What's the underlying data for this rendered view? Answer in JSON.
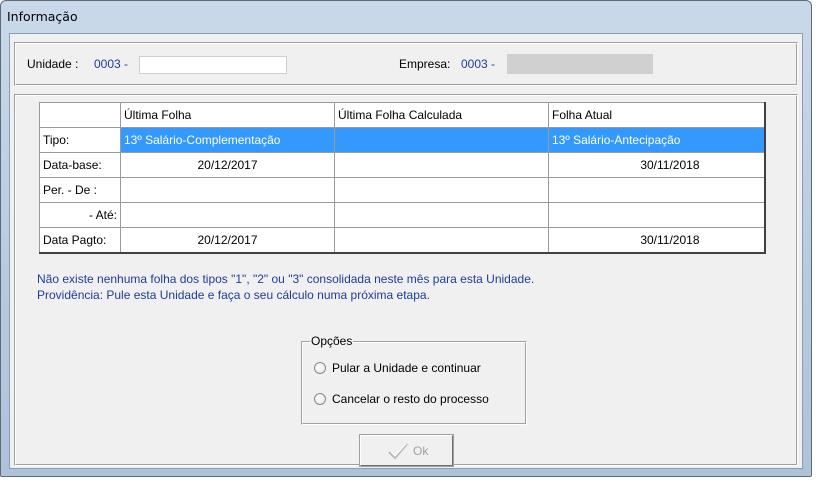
{
  "window": {
    "title": "Informação"
  },
  "header": {
    "unidade_label": "Unidade :",
    "unidade_value": "0003 -",
    "empresa_label": "Empresa:",
    "empresa_value": "0003 -"
  },
  "table": {
    "columns": [
      "",
      "Última Folha",
      "Última Folha Calculada",
      "Folha Atual"
    ],
    "rows": [
      {
        "label": "Tipo:",
        "ultima": "13º Salário-Complementação",
        "calculada": "",
        "atual": "13º Salário-Antecipação"
      },
      {
        "label": "Data-base:",
        "ultima": "20/12/2017",
        "calculada": "",
        "atual": "30/11/2018"
      },
      {
        "label": "Per. - De :",
        "ultima": "",
        "calculada": "",
        "atual": ""
      },
      {
        "label": "- Até:",
        "ultima": "",
        "calculada": "",
        "atual": ""
      },
      {
        "label": "Data Pagto:",
        "ultima": "20/12/2017",
        "calculada": "",
        "atual": "30/11/2018"
      }
    ]
  },
  "messages": {
    "line1": "Não existe nenhuma folha dos tipos \"1\", \"2\" ou \"3\" consolidada neste mês para esta Unidade.",
    "line2": "Providência: Pule esta Unidade e faça o seu cálculo numa próxima etapa."
  },
  "options": {
    "legend": "Opções",
    "items": [
      "Pular a Unidade e continuar",
      "Cancelar o resto do processo"
    ]
  },
  "ok_button": {
    "label": "Ok",
    "enabled": false
  },
  "colors": {
    "selection": "#3399ff",
    "info_text": "#1c3d9b"
  }
}
